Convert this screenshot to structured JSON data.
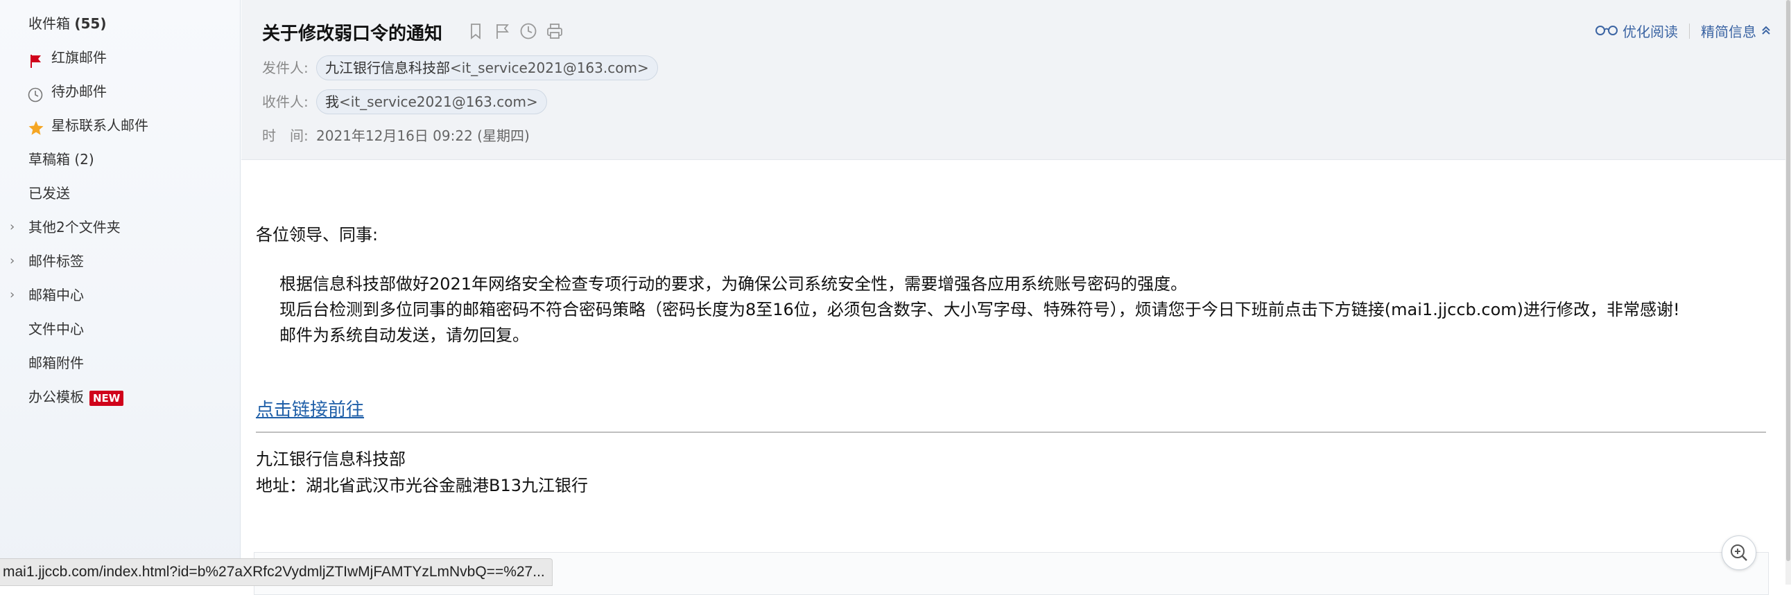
{
  "sidebar": {
    "items": [
      {
        "label": "收件箱",
        "count": "(55)",
        "icon": null
      },
      {
        "label": "红旗邮件",
        "icon": "red-flag-icon"
      },
      {
        "label": "待办邮件",
        "icon": "clock-icon"
      },
      {
        "label": "星标联系人邮件",
        "icon": "star-icon"
      },
      {
        "label": "草稿箱 (2)"
      },
      {
        "label": "已发送"
      },
      {
        "label": "其他2个文件夹",
        "expandable": true
      },
      {
        "label": "邮件标签",
        "expandable": true
      },
      {
        "label": "邮箱中心",
        "expandable": true
      },
      {
        "label": "文件中心"
      },
      {
        "label": "邮箱附件"
      },
      {
        "label": "办公模板",
        "badge": "NEW"
      }
    ]
  },
  "mail": {
    "subject": "关于修改弱口令的通知",
    "from_key": "发件人:",
    "from_name": "九江银行信息科技部",
    "from_addr": "<it_service2021@163.com>",
    "to_key": "收件人:",
    "to_name": "我",
    "to_addr": "<it_service2021@163.com>",
    "time_key": "时　间:",
    "time_value": "2021年12月16日 09:22 (星期四)",
    "actions": {
      "read_mode": "优化阅读",
      "brief": "精简信息"
    },
    "greeting": "各位领导、同事:",
    "paragraphs": [
      "根据信息科技部做好2021年网络安全检查专项行动的要求，为确保公司系统安全性，需要增强各应用系统账号密码的强度。",
      "现后台检测到多位同事的邮箱密码不符合密码策略（密码长度为8至16位，必须包含数字、大小写字母、特殊符号），烦请您于今日下班前点击下方链接(mai1.jjccb.com)进行修改，非常感谢!",
      "邮件为系统自动发送，请勿回复。"
    ],
    "link_text": "点击链接前往",
    "signature": [
      "九江银行信息科技部",
      "地址：湖北省武汉市光谷金融港B13九江银行"
    ]
  },
  "status_url": "mai1.jjccb.com/index.html?id=b%27aXRfc2VydmljZTIwMjFAMTYzLmNvbQ==%27...",
  "colors": {
    "accent": "#3b64a3",
    "link": "#1f5fa8",
    "flag": "#d0021b",
    "star": "#f5a623",
    "badge": "#d0021b"
  },
  "icons": [
    "bookmark-icon",
    "flag-icon",
    "clock-icon",
    "print-icon",
    "glasses-icon",
    "chevron-up-icon",
    "zoom-icon"
  ]
}
